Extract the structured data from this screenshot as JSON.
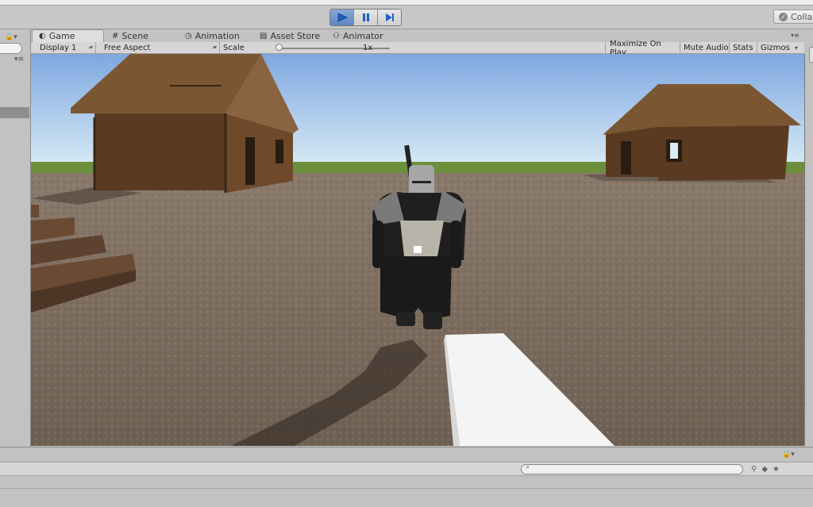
{
  "toolbar": {
    "play": "play-icon",
    "pause": "pause-icon",
    "step": "step-icon",
    "collab_label": "Colla"
  },
  "tabs": [
    {
      "label": "Game",
      "icon": "game-controller-icon"
    },
    {
      "label": "Scene",
      "icon": "grid-icon"
    },
    {
      "label": "Animation",
      "icon": "clock-icon"
    },
    {
      "label": "Asset Store",
      "icon": "store-icon"
    },
    {
      "label": "Animator",
      "icon": "animator-icon"
    }
  ],
  "gamebar": {
    "display": "Display 1",
    "aspect": "Free Aspect",
    "scale_label": "Scale",
    "scale_value": "1x",
    "maximize": "Maximize On Play",
    "mute": "Mute Audio",
    "stats": "Stats",
    "gizmos": "Gizmos"
  },
  "colors": {
    "accent": "#5f86c4",
    "sky_top": "#7ea7e0",
    "sky_horizon": "#d9ecf5",
    "ground": "#7a6a5c",
    "grass": "#6b8f3a"
  }
}
